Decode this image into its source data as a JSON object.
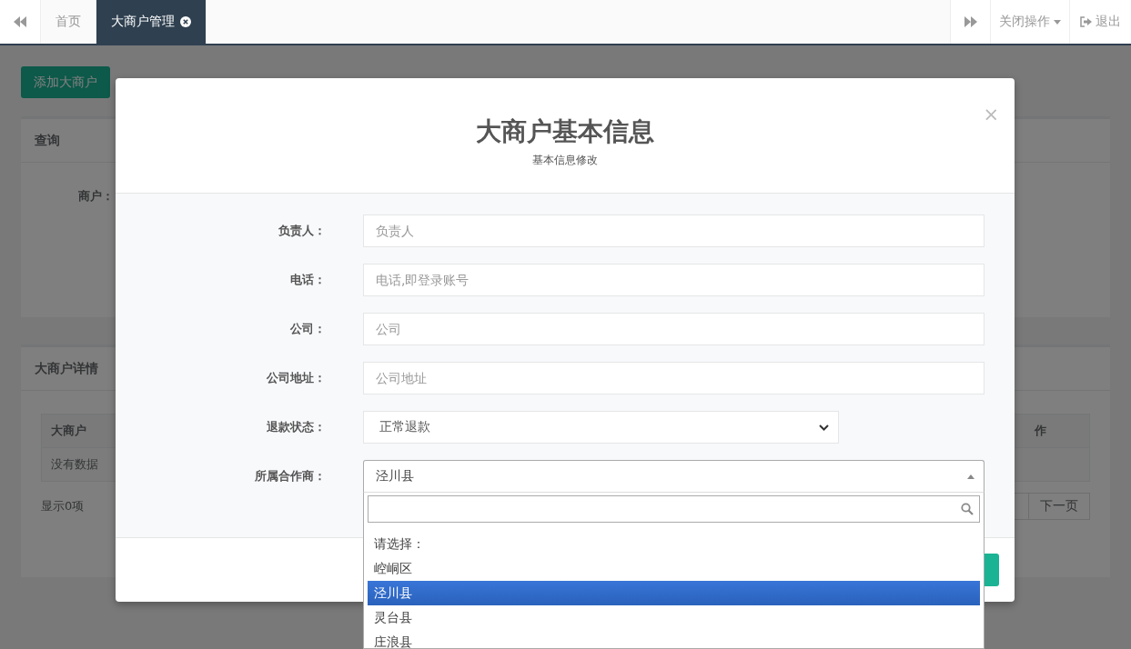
{
  "tabbar": {
    "tabs": [
      {
        "label": "首页",
        "selected": false,
        "closable": false
      },
      {
        "label": "大商户管理",
        "selected": true,
        "closable": true
      }
    ],
    "close_menu": "关闭操作",
    "logout": "退出"
  },
  "page": {
    "add_button": "添加大商户",
    "query_panel": {
      "title": "查询",
      "field_label": "商户："
    },
    "detail_panel": {
      "title": "大商户详情",
      "columns": [
        "大商户",
        "作"
      ],
      "empty_text": "没有数据",
      "summary": "显示0项",
      "pagination": [
        "下一页"
      ]
    }
  },
  "modal": {
    "title": "大商户基本信息",
    "subtitle": "基本信息修改",
    "close": "×",
    "fields": [
      {
        "kind": "input",
        "label": "负责人：",
        "placeholder": "负责人"
      },
      {
        "kind": "input",
        "label": "电话：",
        "placeholder": "电话,即登录账号"
      },
      {
        "kind": "input",
        "label": "公司：",
        "placeholder": "公司"
      },
      {
        "kind": "input",
        "label": "公司地址：",
        "placeholder": "公司地址"
      },
      {
        "kind": "select",
        "label": "退款状态：",
        "value": "正常退款"
      },
      {
        "kind": "combobox",
        "label": "所属合作商：",
        "value": "泾川县",
        "expanded": true,
        "options": [
          {
            "label": "请选择：",
            "selected": false
          },
          {
            "label": "崆峒区",
            "selected": false
          },
          {
            "label": "泾川县",
            "selected": true
          },
          {
            "label": "灵台县",
            "selected": false
          },
          {
            "label": "庄浪县",
            "selected": false
          }
        ]
      }
    ]
  }
}
